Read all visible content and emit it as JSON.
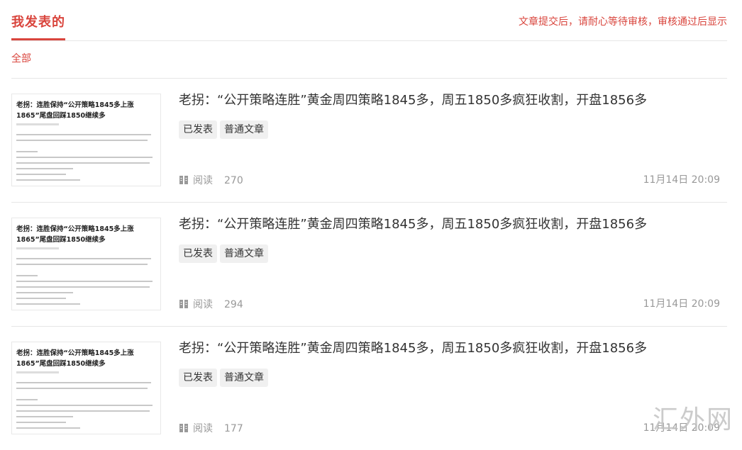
{
  "header": {
    "tab_label": "我发表的",
    "notice": "文章提交后，请耐心等待审核，审核通过后显示"
  },
  "filter": {
    "label": "全部"
  },
  "articles": [
    {
      "title": "老拐：“公开策略连胜”黄金周四策略1845多，周五1850多疯狂收割，开盘1856多",
      "thumb_title": "老拐：连胜保持“公开策略1845多上涨1865”尾盘回踩1850继续多",
      "tags": [
        "已发表",
        "普通文章"
      ],
      "read_label": "阅读",
      "read_count": "270",
      "date": "11月14日 20:09"
    },
    {
      "title": "老拐：“公开策略连胜”黄金周四策略1845多，周五1850多疯狂收割，开盘1856多",
      "thumb_title": "老拐：连胜保持“公开策略1845多上涨1865”尾盘回踩1850继续多",
      "tags": [
        "已发表",
        "普通文章"
      ],
      "read_label": "阅读",
      "read_count": "294",
      "date": "11月14日 20:09"
    },
    {
      "title": "老拐：“公开策略连胜”黄金周四策略1845多，周五1850多疯狂收割，开盘1856多",
      "thumb_title": "老拐：连胜保持“公开策略1845多上涨1865”尾盘回踩1850继续多",
      "tags": [
        "已发表",
        "普通文章"
      ],
      "read_label": "阅读",
      "read_count": "177",
      "date": "11月14日 20:09"
    }
  ],
  "watermark": "汇外网",
  "colors": {
    "accent": "#d9453d",
    "muted": "#999999",
    "tag_bg": "#f0f0f0"
  }
}
